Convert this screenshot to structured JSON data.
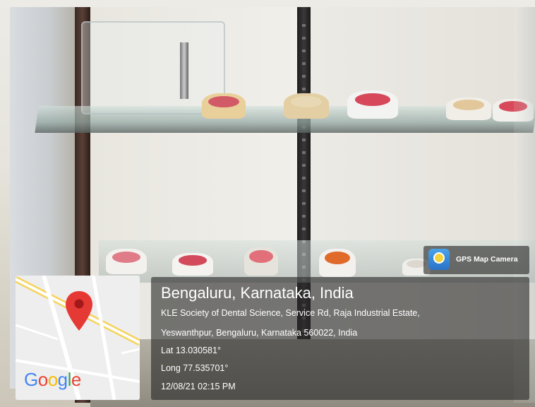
{
  "photo": {
    "description_tags": [
      "display-cabinet",
      "glass-shelves",
      "dental-models"
    ]
  },
  "overlay": {
    "badge_label": "GPS Map Camera",
    "badge_icon": "gps-map-camera-icon",
    "map_logo": "Google",
    "map_logo_colors": [
      "#4285F4",
      "#EA4335",
      "#FBBC05",
      "#4285F4",
      "#34A853",
      "#EA4335"
    ],
    "pin_color": "#E53935",
    "location_title": "Bengaluru, Karnataka, India",
    "address_line1": "KLE Society of Dental Science, Service Rd, Raja Industrial Estate,",
    "address_line2": "Yeswanthpur, Bengaluru, Karnataka 560022, India",
    "latitude": "Lat 13.030581°",
    "longitude": "Long 77.535701°",
    "timestamp": "12/08/21 02:15 PM"
  }
}
